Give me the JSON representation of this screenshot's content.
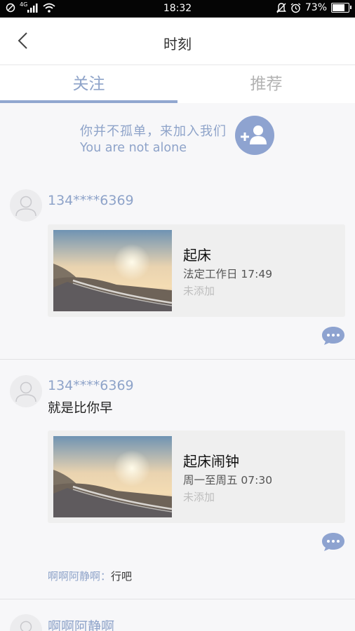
{
  "status_bar": {
    "network_label": "4G",
    "time": "18:32",
    "battery": "73%"
  },
  "header": {
    "title": "时刻"
  },
  "tabs": [
    {
      "label": "关注",
      "active": true
    },
    {
      "label": "推荐",
      "active": false
    }
  ],
  "invite": {
    "text_cn": "你并不孤单，来加入我们",
    "text_en": "You are not alone"
  },
  "posts": [
    {
      "username": "134****6369",
      "text": "",
      "card": {
        "title": "起床",
        "time": "法定工作日 17:49",
        "status": "未添加"
      }
    },
    {
      "username": "134****6369",
      "text": "就是比你早",
      "card": {
        "title": "起床闹钟",
        "time": "周一至周五 07:30",
        "status": "未添加"
      },
      "comments": [
        {
          "user": "啊啊阿静啊",
          "separator": "：",
          "text": "行吧"
        }
      ]
    },
    {
      "username": "啊啊阿静啊"
    }
  ],
  "colors": {
    "accent": "#8ea3c9",
    "tab_indicator": "#91a7d0",
    "button": "#8ea3d0",
    "background": "#f7f7f9"
  },
  "icons": [
    "dnd-icon",
    "signal-icon",
    "wifi-icon",
    "bell-icon",
    "alarm-icon",
    "battery-icon",
    "back-arrow-icon",
    "add-friend-icon",
    "avatar-placeholder-icon",
    "comment-bubble-icon"
  ]
}
